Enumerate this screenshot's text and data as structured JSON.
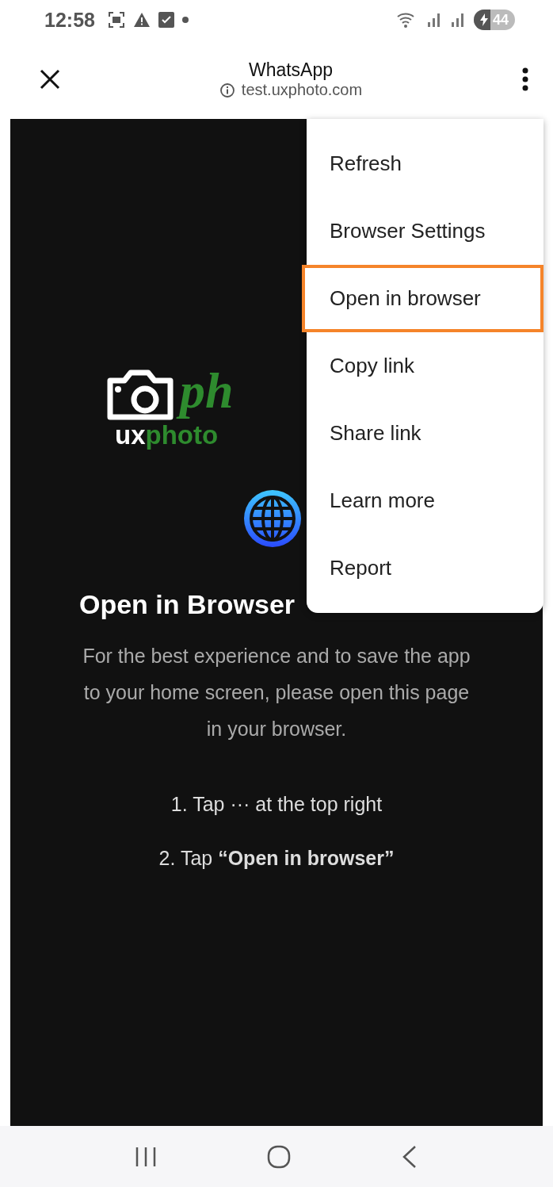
{
  "status_bar": {
    "time": "12:58",
    "battery": "44",
    "charging": true
  },
  "toolbar": {
    "title": "WhatsApp",
    "url": "test.uxphoto.com"
  },
  "page": {
    "logo": {
      "large": "ph",
      "prefix": "ux",
      "rest": "photo"
    },
    "heading": "Open in Browser",
    "body": "For the best experience and to save the app to your home screen, please open this page in your browser.",
    "steps": [
      "1. Tap ··· at the top right",
      "2. Tap **“Open in browser”**"
    ]
  },
  "menu": {
    "items": [
      {
        "label": "Refresh",
        "highlighted": false
      },
      {
        "label": "Browser Settings",
        "highlighted": false
      },
      {
        "label": "Open in browser",
        "highlighted": true
      },
      {
        "label": "Copy link",
        "highlighted": false
      },
      {
        "label": "Share link",
        "highlighted": false
      },
      {
        "label": "Learn more",
        "highlighted": false
      },
      {
        "label": "Report",
        "highlighted": false
      }
    ]
  }
}
